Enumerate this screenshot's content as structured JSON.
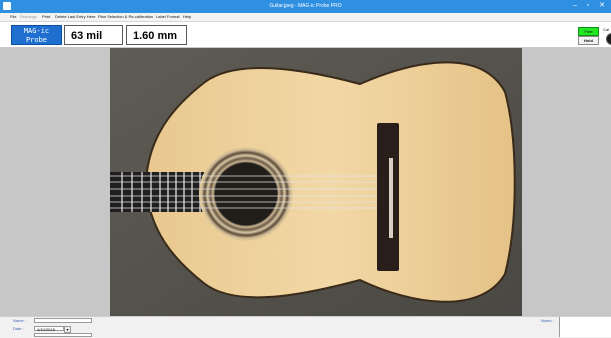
{
  "window": {
    "title": "Guitar.jpeg - MAG-ic Probe PRO",
    "minimize_glyph": "–",
    "maximize_glyph": "▫",
    "close_glyph": "✕"
  },
  "menu": {
    "items": [
      {
        "label": "File",
        "enabled": true
      },
      {
        "label": "Readings",
        "enabled": false
      },
      {
        "label": "Print",
        "enabled": true
      },
      {
        "label": "Delete Last Entry Here",
        "enabled": true
      },
      {
        "label": "Plan Selection & Re-calibration",
        "enabled": true
      },
      {
        "label": "Label Format",
        "enabled": true
      },
      {
        "label": "Help",
        "enabled": true
      }
    ]
  },
  "logo": {
    "line1": "MAG-ic",
    "line2": "Probe"
  },
  "readouts": {
    "mil": "63 mil",
    "mm": "1.60 mm"
  },
  "mode_buttons": {
    "free": "Free",
    "hold": "Hold"
  },
  "edge_label": "Cal",
  "bottom": {
    "name_label": "Name :",
    "name_value": "",
    "date_label": "Date :",
    "date_value": "4/10/2018",
    "notes_label": "Notes :"
  },
  "colors": {
    "titlebar": "#2f8fe0",
    "logo": "#1f6fd0",
    "free_button": "#22e622",
    "stage": "#c7c7c7"
  }
}
